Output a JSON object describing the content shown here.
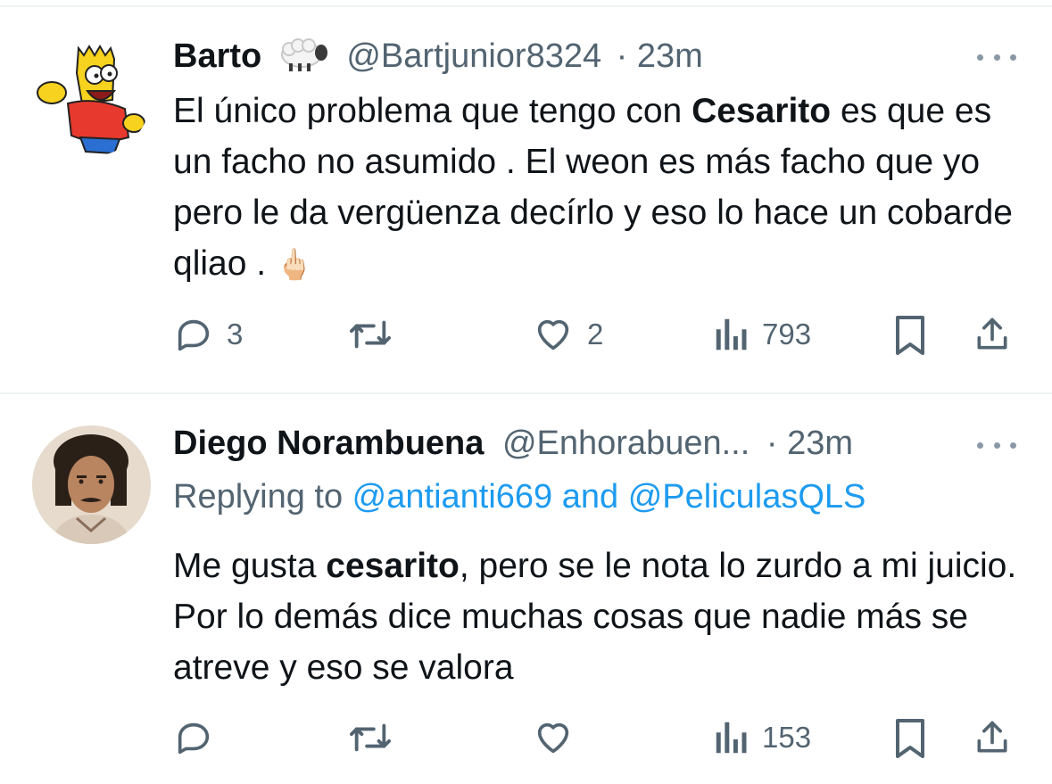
{
  "tweets": [
    {
      "name": "Barto",
      "name_emoji": "sheep",
      "handle": "@Bartjunior8324",
      "separator": "·",
      "time": "23m",
      "text_parts": [
        "El único problema que tengo con ",
        "Cesarito",
        " es que es un facho no asumido . El weon es más facho que yo pero le da vergüenza decírlo y eso lo hace un cobarde qliao . "
      ],
      "trailing_emoji": "🖕🏻",
      "replies": "3",
      "retweets": "",
      "likes": "2",
      "views": "793",
      "avatar_icon": "bart-simpson-avatar"
    },
    {
      "name": "Diego Norambuena",
      "handle": "@Enhorabuen...",
      "separator": "·",
      "time": "23m",
      "replying_prefix": "Replying to ",
      "replying_user1": "@antianti669",
      "replying_and": " and ",
      "replying_user2": "@PeliculasQLS",
      "text_parts": [
        "Me gusta ",
        "cesarito",
        ", pero se le nota lo zurdo a mi juicio. Por lo demás dice muchas cosas que nadie más se atreve y eso se valora"
      ],
      "replies": "",
      "retweets": "",
      "likes": "",
      "views": "153",
      "avatar_icon": "profile-photo-avatar"
    }
  ],
  "icons": {
    "reply": "reply-icon",
    "retweet": "retweet-icon",
    "like": "heart-icon",
    "views": "views-icon",
    "bookmark": "bookmark-icon",
    "share": "share-icon",
    "more": "more-icon"
  },
  "colors": {
    "text": "#0f1419",
    "secondary": "#536471",
    "link": "#1d9bf0",
    "divider": "#eff3f4"
  }
}
